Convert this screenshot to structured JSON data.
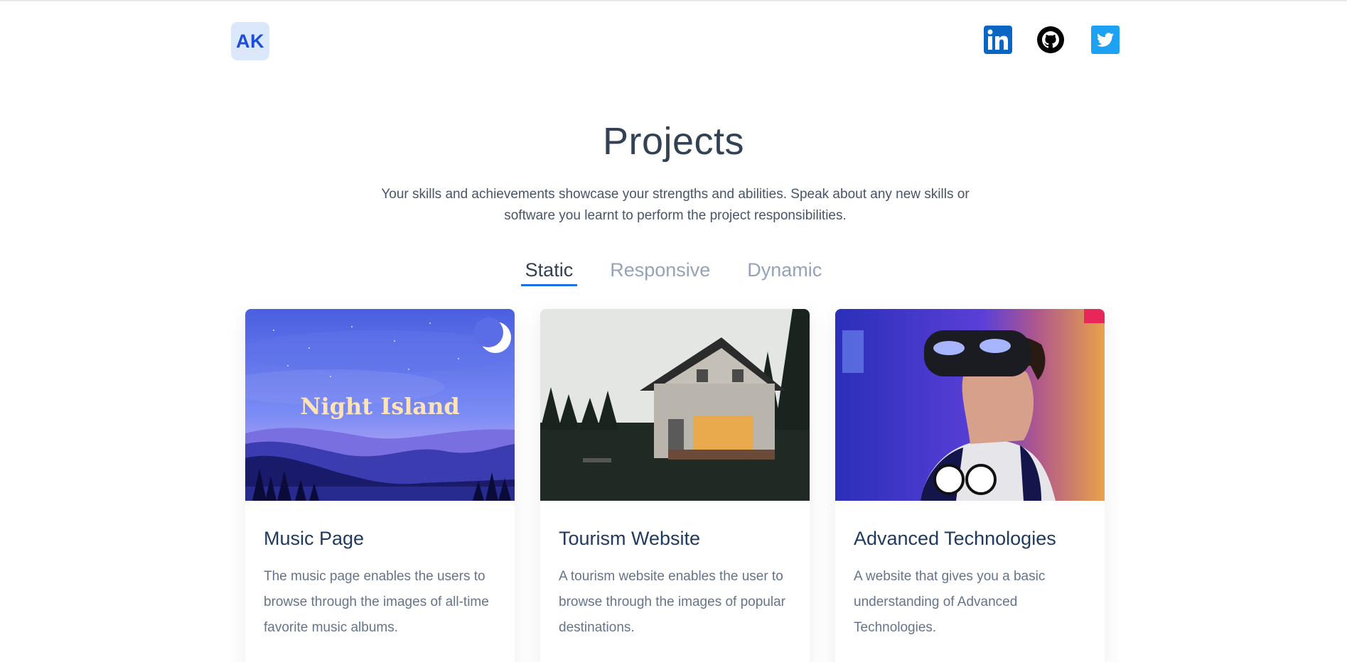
{
  "header": {
    "logo_text": "AK",
    "social": [
      {
        "icon": "linkedin-icon",
        "color": "#0a66c2"
      },
      {
        "icon": "github-icon",
        "color": "#000000"
      },
      {
        "icon": "twitter-icon",
        "color": "#1da1f2"
      }
    ]
  },
  "hero": {
    "title": "Projects",
    "subtitle": "Your skills and achievements showcase your strengths and abilities. Speak about any new skills or software you learnt to perform the project responsibilities."
  },
  "tabs": [
    {
      "label": "Static",
      "active": true
    },
    {
      "label": "Responsive",
      "active": false
    },
    {
      "label": "Dynamic",
      "active": false
    }
  ],
  "cards": [
    {
      "image_text": "Night Island",
      "title": "Music Page",
      "description": "The music page enables the users to browse through the images of all-time favorite music albums."
    },
    {
      "image_text": "",
      "title": "Tourism Website",
      "description": "A tourism website enables the user to browse through the images of popular destinations."
    },
    {
      "image_text": "",
      "title": "Advanced Technologies",
      "description": "A website that gives you a basic understanding of Advanced Technologies."
    }
  ],
  "colors": {
    "accent": "#1d70e0",
    "heading": "#334155",
    "muted": "#94a3b8"
  }
}
